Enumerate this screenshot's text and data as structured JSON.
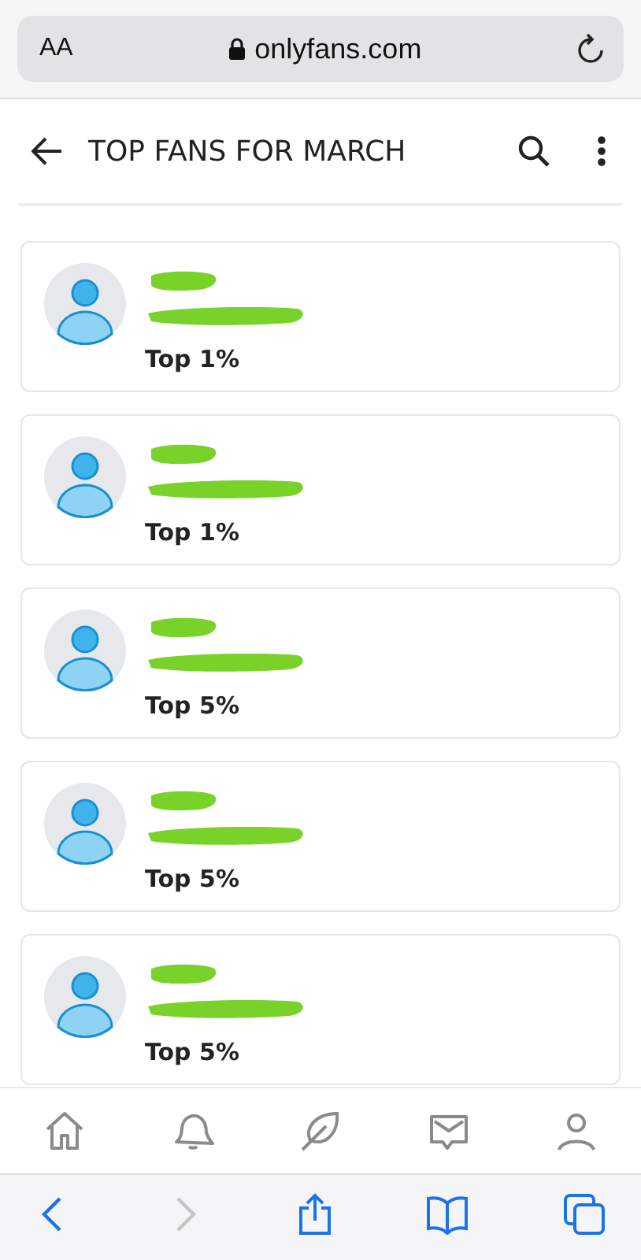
{
  "browser": {
    "text_size": "AA",
    "url": "onlyfans.com"
  },
  "header": {
    "title": "TOP FANS FOR MARCH"
  },
  "fans": [
    {
      "rank": "Top 1%"
    },
    {
      "rank": "Top 1%"
    },
    {
      "rank": "Top 5%"
    },
    {
      "rank": "Top 5%"
    },
    {
      "rank": "Top 5%"
    }
  ],
  "nav": [
    {
      "kind": "home",
      "selected": false
    },
    {
      "kind": "bell",
      "selected": false
    },
    {
      "kind": "leaf",
      "selected": false
    },
    {
      "kind": "mail",
      "selected": false
    },
    {
      "kind": "person",
      "selected": false
    }
  ],
  "browser_toolbar": [
    {
      "kind": "back",
      "disabled": false
    },
    {
      "kind": "forward",
      "disabled": true
    },
    {
      "kind": "share",
      "disabled": false
    },
    {
      "kind": "book",
      "disabled": false
    },
    {
      "kind": "tabs",
      "disabled": false
    }
  ]
}
